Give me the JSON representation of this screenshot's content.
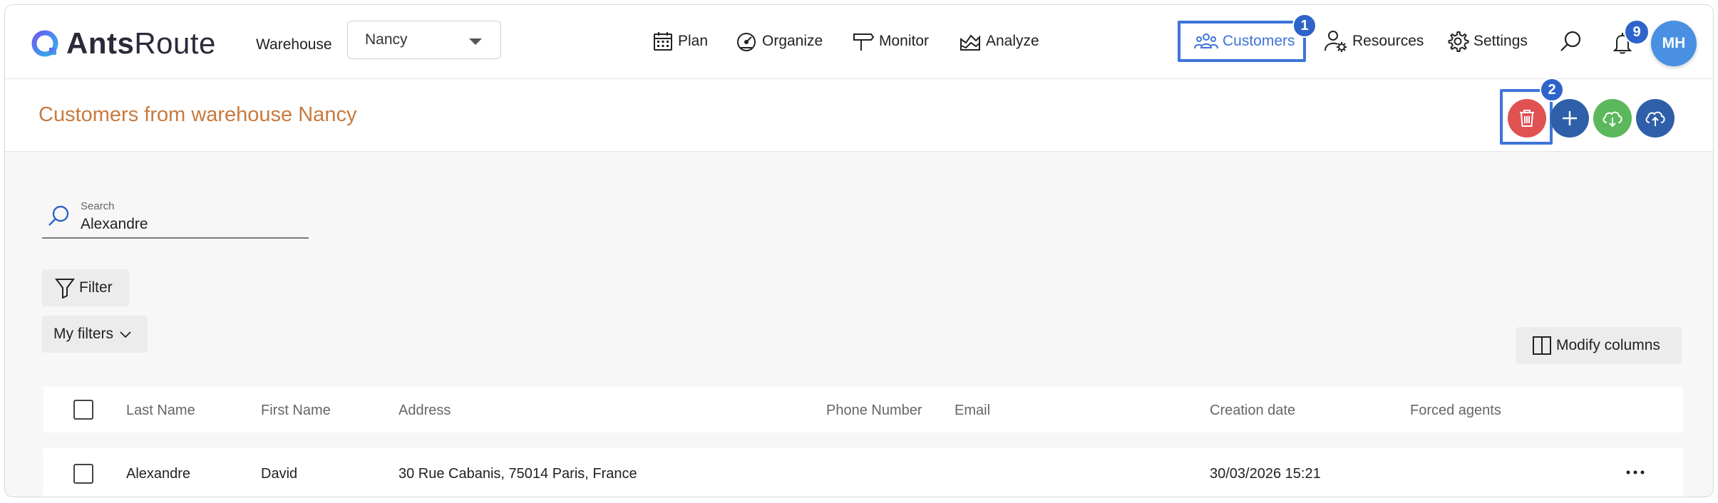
{
  "brand": {
    "name_bold": "Ants",
    "name_regular": "Route"
  },
  "warehouse": {
    "label": "Warehouse",
    "selected": "Nancy"
  },
  "nav": {
    "plan": "Plan",
    "organize": "Organize",
    "monitor": "Monitor",
    "analyze": "Analyze",
    "customers": "Customers",
    "resources": "Resources",
    "settings": "Settings"
  },
  "annotations": {
    "customers_marker": "1",
    "delete_marker": "2"
  },
  "notifications": {
    "count": "9"
  },
  "user": {
    "initials": "MH"
  },
  "page": {
    "title": "Customers from warehouse Nancy"
  },
  "search": {
    "label": "Search",
    "value": "Alexandre"
  },
  "filters": {
    "filter_label": "Filter",
    "my_filters_label": "My filters"
  },
  "modify_columns_label": "Modify columns",
  "table": {
    "columns": [
      "Last Name",
      "First Name",
      "Address",
      "Phone Number",
      "Email",
      "Creation date",
      "Forced agents"
    ],
    "rows": [
      {
        "last_name": "Alexandre",
        "first_name": "David",
        "address": "30 Rue Cabanis, 75014 Paris, France",
        "phone": "",
        "email": "",
        "created": "30/03/2026 15:21",
        "forced_agents": ""
      }
    ]
  },
  "colors": {
    "accent": "#3d74d9",
    "title_orange": "#c87a3e",
    "delete_red": "#e05252",
    "add_blue": "#2f5fa8",
    "import_green": "#5cb85c",
    "upload_blue": "#2f5fa8",
    "avatar_blue": "#4a90e2"
  },
  "icons": {
    "plan": "calendar-icon",
    "organize": "speedometer-icon",
    "monitor": "signpost-icon",
    "analyze": "area-chart-icon",
    "customers": "people-icon",
    "resources": "user-gear-icon",
    "settings": "gear-icon",
    "search": "search-icon",
    "notifications": "bell-icon",
    "delete": "trash-icon",
    "add": "plus-icon",
    "import": "cloud-download-icon",
    "upload": "cloud-upload-icon",
    "filter": "funnel-icon",
    "columns": "columns-icon",
    "row_menu": "ellipsis-icon"
  }
}
